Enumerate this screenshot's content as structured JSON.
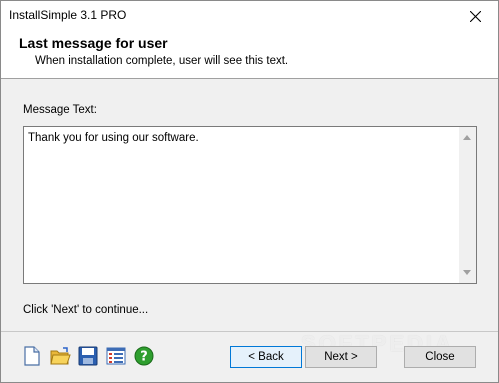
{
  "window": {
    "title": "InstallSimple 3.1 PRO"
  },
  "header": {
    "title": "Last message for user",
    "subtitle": "When installation complete, user will see this text."
  },
  "message": {
    "label": "Message Text:",
    "text": "Thank you for using our software."
  },
  "hint": "Click 'Next' to continue...",
  "toolbar_icons": [
    "new-file-icon",
    "open-folder-icon",
    "save-disk-icon",
    "list-settings-icon",
    "help-icon"
  ],
  "buttons": {
    "back": "< Back",
    "next": "Next >",
    "close": "Close"
  },
  "watermark": "SOFTPEDIA",
  "colors": {
    "header_bg": "#ffffff",
    "dialog_bg": "#f0f0f0",
    "accent": "#0078d7",
    "help_green": "#2e9e2e"
  }
}
